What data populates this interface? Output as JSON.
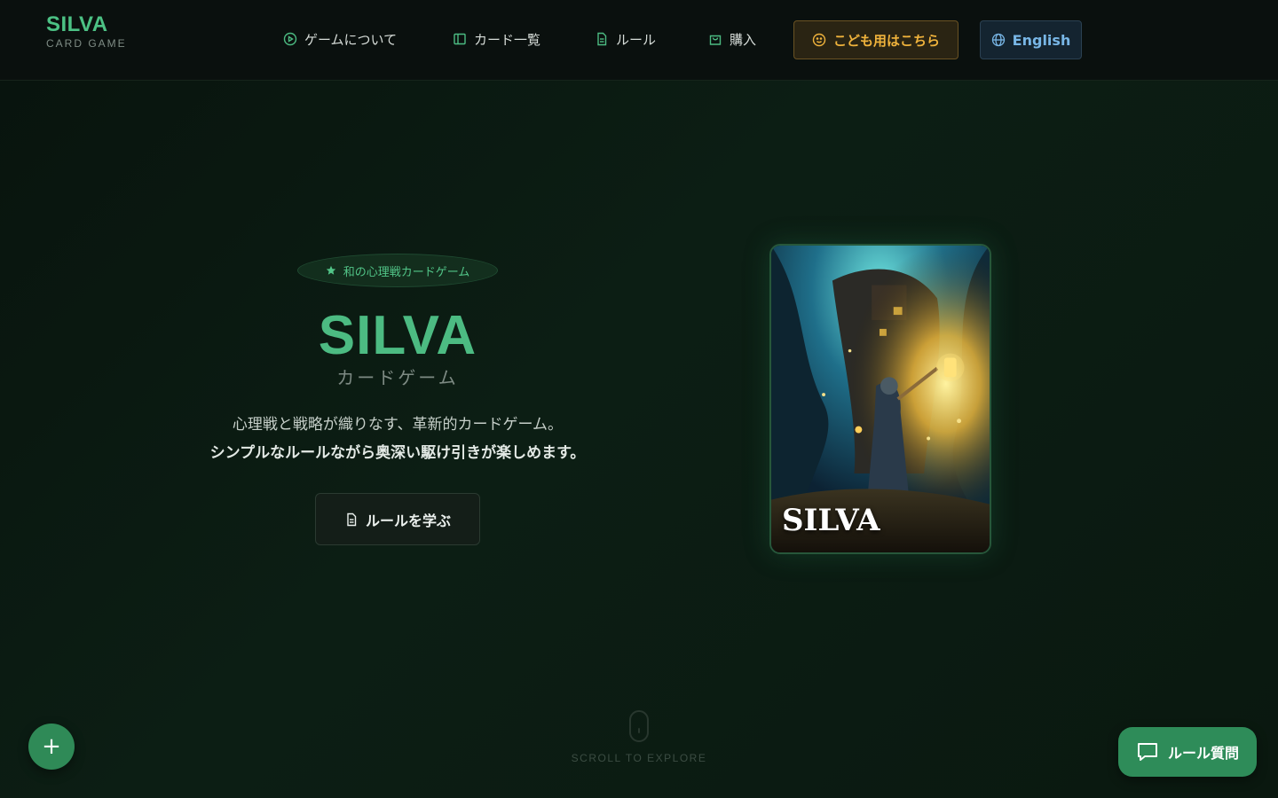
{
  "brand": {
    "title": "SILVA",
    "subtitle": "CARD GAME"
  },
  "nav": {
    "items": [
      {
        "label": "ゲームについて",
        "icon": "play-circle-icon"
      },
      {
        "label": "カード一覧",
        "icon": "sidebar-panel-icon"
      },
      {
        "label": "ルール",
        "icon": "document-icon"
      },
      {
        "label": "購入",
        "icon": "shopping-bag-icon"
      }
    ],
    "kids_label": "こども用はこちら",
    "lang_label": "English"
  },
  "hero": {
    "badge": "和の心理戦カードゲーム",
    "title": "SILVA",
    "subtitle": "カードゲーム",
    "desc_line1": "心理戦と戦略が織りなす、革新的カードゲーム。",
    "desc_line2": "シンプルなルールながら奥深い駆け引きが楽しめます。",
    "cta_label": "ルールを学ぶ"
  },
  "card": {
    "title": "SILVA"
  },
  "scroll": {
    "label": "SCROLL TO EXPLORE"
  },
  "fab": {
    "plus": "+",
    "chat_label": "ルール質問"
  },
  "colors": {
    "accent": "#4cbb82",
    "kids": "#f0b33c",
    "lang": "#78b6e6",
    "fab": "#2e8c59"
  }
}
